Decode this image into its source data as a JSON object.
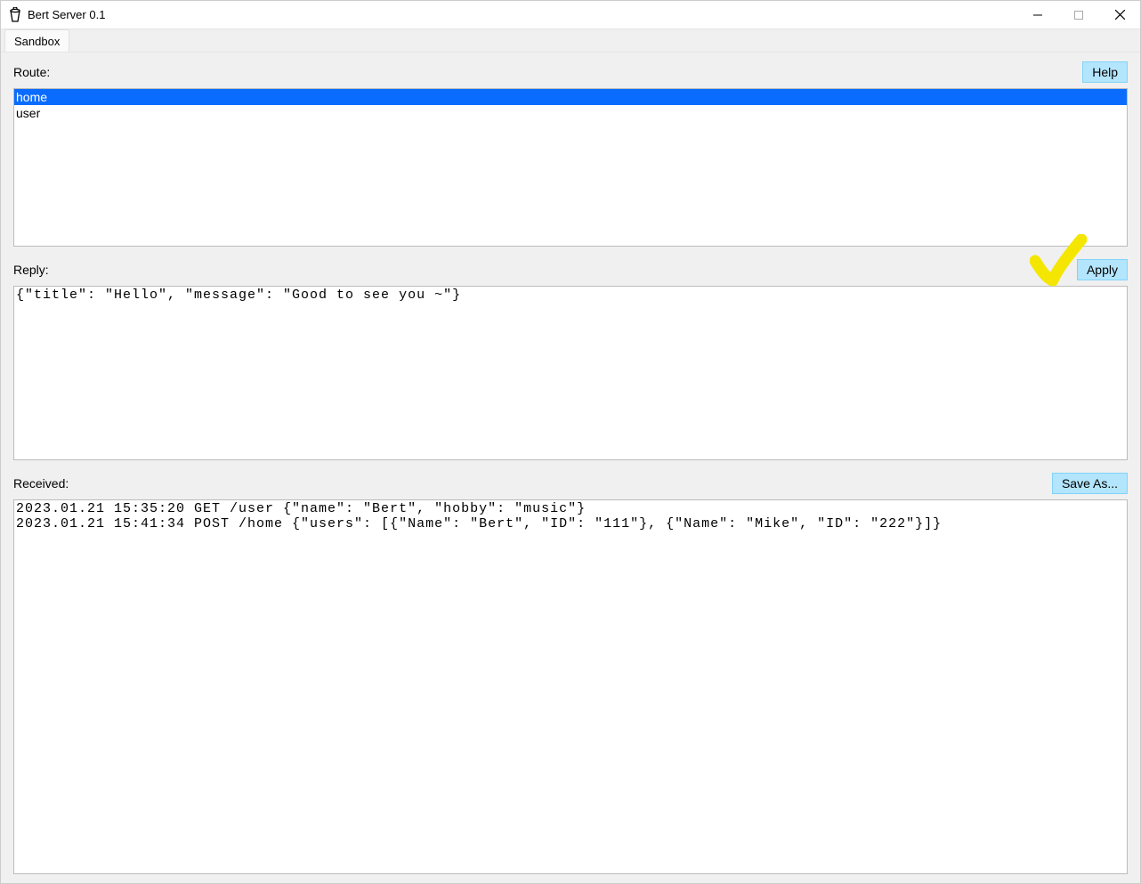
{
  "titlebar": {
    "title": "Bert Server 0.1"
  },
  "menubar": {
    "sandbox": "Sandbox"
  },
  "labels": {
    "route": "Route:",
    "reply": "Reply:",
    "received": "Received:"
  },
  "buttons": {
    "help": "Help",
    "apply": "Apply",
    "save_as": "Save As..."
  },
  "routes": [
    {
      "name": "home",
      "selected": true
    },
    {
      "name": "user",
      "selected": false
    }
  ],
  "reply_text": "{\"title\": \"Hello\", \"message\": \"Good to see you ~\"}",
  "received_text": "2023.01.21 15:35:20 GET /user {\"name\": \"Bert\", \"hobby\": \"music\"}\n2023.01.21 15:41:34 POST /home {\"users\": [{\"Name\": \"Bert\", \"ID\": \"111\"}, {\"Name\": \"Mike\", \"ID\": \"222\"}]}"
}
